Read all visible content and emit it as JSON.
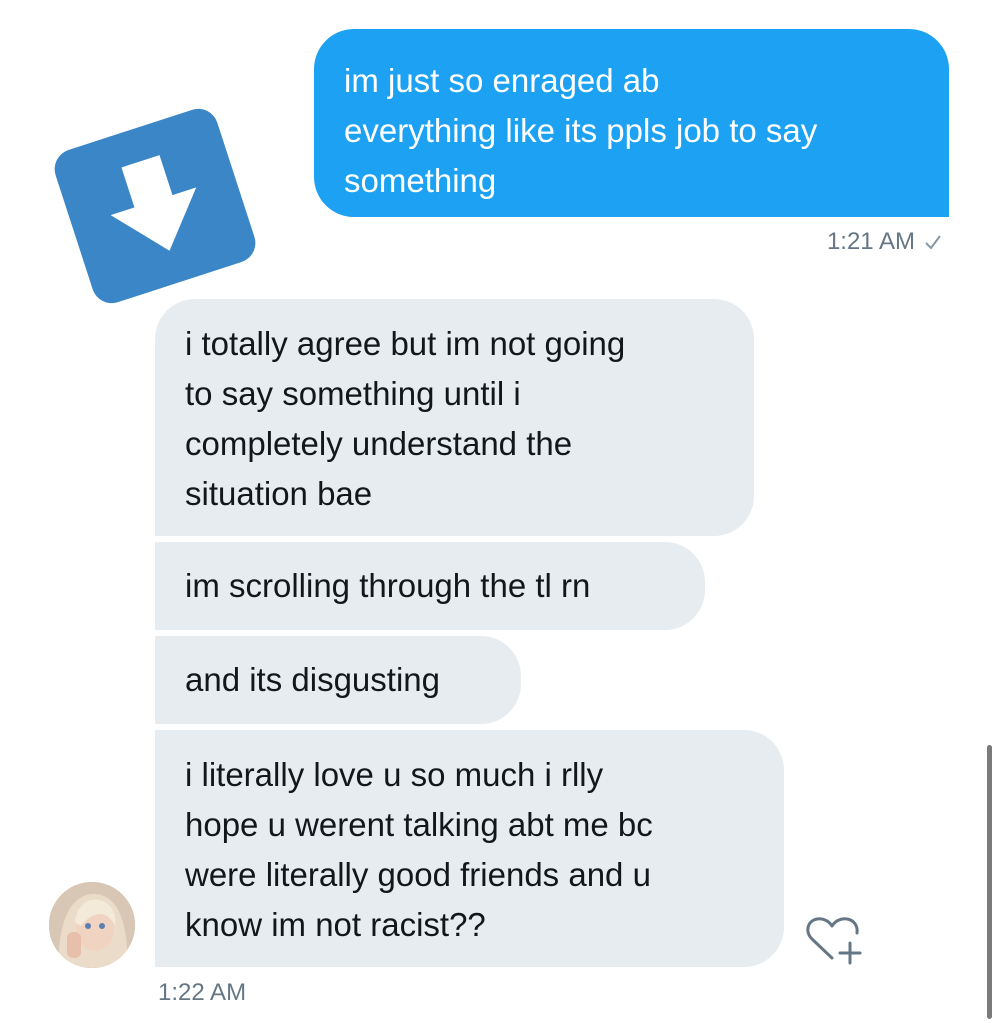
{
  "conversation": {
    "sent": [
      {
        "text": "im just so enraged ab\neverything like its ppls job to say\nsomething",
        "time": "1:21 AM",
        "status": "read-check"
      }
    ],
    "received": [
      {
        "text": "i totally agree but im not going\nto say something until i\ncompletely understand the\nsituation bae"
      },
      {
        "text": "im scrolling through the tl rn"
      },
      {
        "text": "and its disgusting"
      },
      {
        "text": "i literally love u so much i rlly\nhope u werent talking abt me bc\nwere literally good friends and u\nknow im not racist??"
      }
    ],
    "received_time": "1:22 AM"
  },
  "icons": {
    "badge": "download-arrow-icon",
    "check": "check-icon",
    "reaction": "heart-plus-icon"
  },
  "colors": {
    "sent_bubble": "#1da1f2",
    "received_bubble": "#e6ecf0",
    "badge": "#3b86c6",
    "timestamp": "#657786"
  }
}
